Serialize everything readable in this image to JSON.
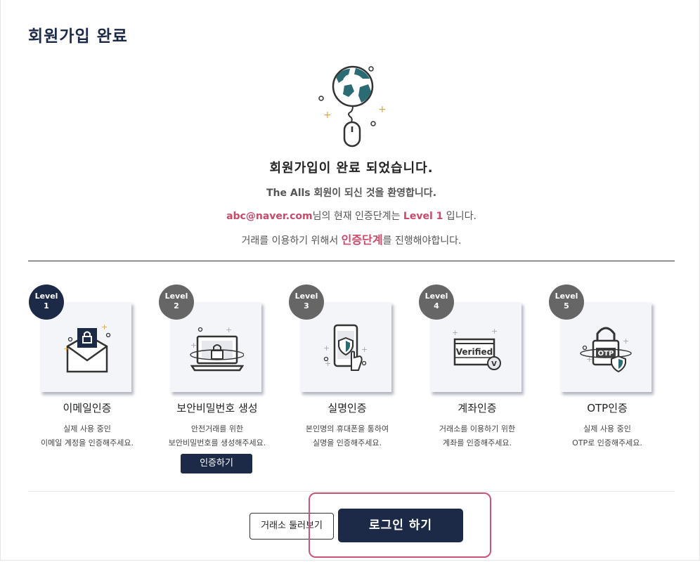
{
  "page": {
    "title": "회원가입 완료"
  },
  "message": {
    "headline": "회원가입이 완료 되었습니다.",
    "welcome": "The Alls 회원이 되신 것을 환영합니다.",
    "email": "abc@naver.com",
    "status_mid": "님의 현재 인증단계는 ",
    "level": "Level 1",
    "status_end": " 입니다.",
    "trade_pre": "거래를 이용하기 위해서 ",
    "trade_accent": "인증단계",
    "trade_post": "를 진행해야합니다."
  },
  "steps": [
    {
      "badge_top": "Level",
      "badge_num": "1",
      "title": "이메일인증",
      "desc1": "실제 사용 중인",
      "desc2": "이메일 계정을 인증해주세요.",
      "icon": "envelope-lock-icon"
    },
    {
      "badge_top": "Level",
      "badge_num": "2",
      "title": "보안비밀번호 생성",
      "desc1": "안전거래를 위한",
      "desc2": "보안비밀번호를 생성해주세요.",
      "icon": "laptop-lock-icon"
    },
    {
      "badge_top": "Level",
      "badge_num": "3",
      "title": "실명인증",
      "desc1": "본인명의 휴대폰을 통하여",
      "desc2": "실명을 인증해주세요.",
      "icon": "phone-shield-icon"
    },
    {
      "badge_top": "Level",
      "badge_num": "4",
      "title": "계좌인증",
      "desc1": "거래소를 이용하기 위한",
      "desc2": "계좌를 인증해주세요.",
      "icon": "verified-card-icon",
      "card_text": "Verified"
    },
    {
      "badge_top": "Level",
      "badge_num": "5",
      "title": "OTP인증",
      "desc1": "실제 사용 중인",
      "desc2": "OTP로 인증해주세요.",
      "icon": "otp-padlock-icon",
      "card_text": "OTP"
    }
  ],
  "actions": {
    "verify": "인증하기",
    "browse": "거래소 둘러보기",
    "login": "로그인 하기"
  },
  "colors": {
    "navy": "#1c2a48",
    "accent": "#c94a6a",
    "badge_gray": "#666666"
  }
}
